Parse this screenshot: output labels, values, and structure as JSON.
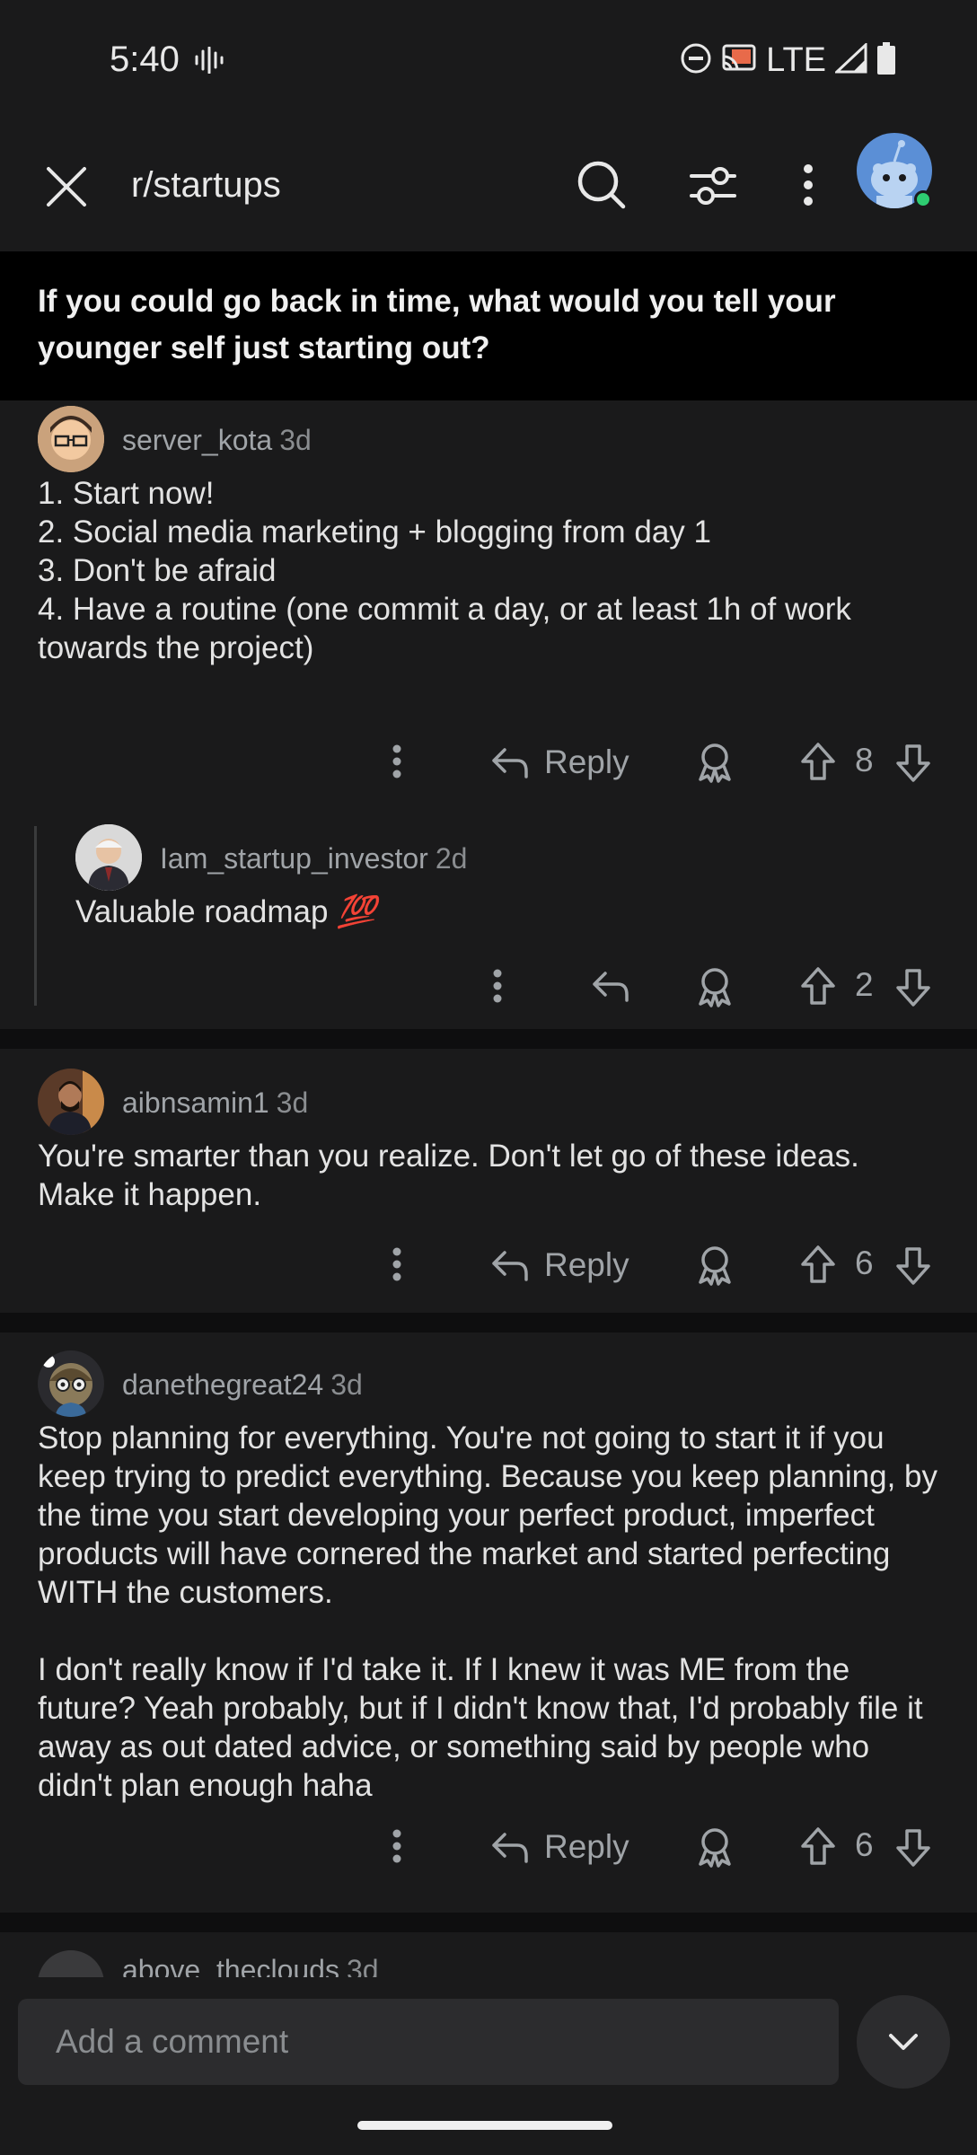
{
  "status_bar": {
    "time": "5:40",
    "network": "LTE"
  },
  "app_bar": {
    "subreddit": "r/startups"
  },
  "post": {
    "title": "If you could go back in time, what would you tell your younger self just starting out?"
  },
  "comments": [
    {
      "author": "server_kota",
      "age": "3d",
      "body": "1. Start now!\n2. Social media marketing + blogging from day 1\n3. Don't be afraid\n4. Have a routine (one commit a day, or at least 1h of work towards the project)",
      "reply_label": "Reply",
      "score": "8"
    },
    {
      "author": "Iam_startup_investor",
      "age": "2d",
      "body": "Valuable roadmap ",
      "emoji": "💯",
      "score": "2"
    },
    {
      "author": "aibnsamin1",
      "age": "3d",
      "body": "You're smarter than you realize. Don't let go of these ideas. Make it happen.",
      "reply_label": "Reply",
      "score": "6"
    },
    {
      "author": "danethegreat24",
      "age": "3d",
      "body": "Stop planning for everything. You're not going to start it if you keep trying to predict everything. Because you keep planning, by the time you start developing your perfect product, imperfect products will have cornered the market and started perfecting WITH the customers.\n\nI don't really know if I'd take it. If I knew it was ME from the future? Yeah probably, but if I didn't know that, I'd probably file it away as out dated advice, or something said by people who didn't plan enough haha",
      "reply_label": "Reply",
      "score": "6"
    },
    {
      "author": "above_theclouds",
      "age": "3d"
    }
  ],
  "composer": {
    "placeholder": "Add a comment"
  },
  "icons": {
    "close": "close-icon",
    "search": "search-icon",
    "filter": "filter-icon",
    "more": "more-vertical-icon",
    "reply": "reply-arrow-icon",
    "award": "award-icon",
    "upvote": "upvote-arrow-icon",
    "downvote": "downvote-arrow-icon",
    "collapse": "chevron-down-icon"
  },
  "colors": {
    "background": "#1a1a1b",
    "title_bar": "#000000",
    "online": "#2ecc71",
    "avatar_bg": "#5b8fd6"
  }
}
